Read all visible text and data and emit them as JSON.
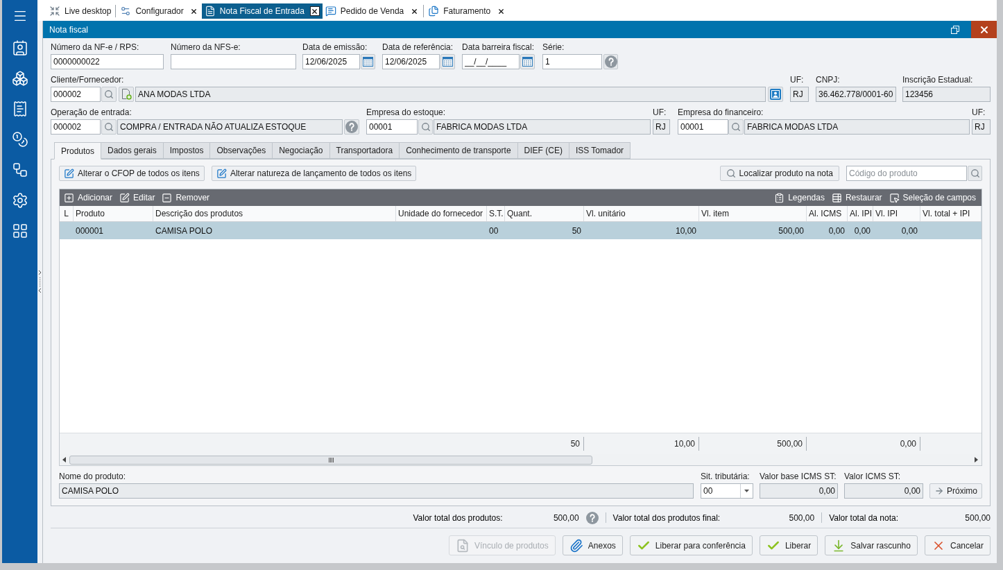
{
  "tabs": [
    {
      "label": "Live desktop",
      "selected": false,
      "closable": false
    },
    {
      "label": "Configurador",
      "selected": false,
      "closable": true
    },
    {
      "label": "Nota Fiscal de Entrada",
      "selected": true,
      "closable": true
    },
    {
      "label": "Pedido de Venda",
      "selected": false,
      "closable": true
    },
    {
      "label": "Faturamento",
      "selected": false,
      "closable": true
    }
  ],
  "window": {
    "title": "Nota fiscal"
  },
  "document": {
    "nfe_number": {
      "label": "Número da NF-e / RPS:",
      "value": "0000000022"
    },
    "nfse_number": {
      "label": "Número da NFS-e:"
    },
    "issue_date": {
      "label": "Data de emissão:",
      "value": "12/06/2025"
    },
    "reference_date": {
      "label": "Data de referência:",
      "value": "12/06/2025"
    },
    "fiscal_barrier_date": {
      "label": "Data barreira fiscal:",
      "value": "__/__/____"
    },
    "series": {
      "label": "Série:",
      "value": "1"
    }
  },
  "supplier": {
    "label": "Cliente/Fornecedor:",
    "code": "000002",
    "name": "ANA MODAS LTDA",
    "uf": {
      "label": "UF:",
      "value": "RJ"
    },
    "cnpj": {
      "label": "CNPJ:",
      "value": "36.462.778/0001-60"
    },
    "state_registration": {
      "label": "Inscrição Estadual:",
      "value": "123456"
    }
  },
  "operation": {
    "label": "Operação de entrada:",
    "code": "000002",
    "description": "COMPRA / ENTRADA NÃO ATUALIZA ESTOQUE"
  },
  "stock_company": {
    "label": "Empresa do estoque:",
    "code": "00001",
    "name": "FABRICA MODAS LTDA",
    "uf": {
      "label": "UF:",
      "value": "RJ"
    }
  },
  "finance_company": {
    "label": "Empresa do financeiro:",
    "code": "00001",
    "name": "FABRICA MODAS LTDA",
    "uf": {
      "label": "UF:",
      "value": "RJ"
    }
  },
  "section_tabs": [
    {
      "label": "Produtos",
      "selected": true
    },
    {
      "label": "Dados gerais",
      "selected": false
    },
    {
      "label": "Impostos",
      "selected": false
    },
    {
      "label": "Observações",
      "selected": false
    },
    {
      "label": "Negociação",
      "selected": false
    },
    {
      "label": "Transportadora",
      "selected": false
    },
    {
      "label": "Conhecimento de transporte",
      "selected": false
    },
    {
      "label": "DIEF (CE)",
      "selected": false
    },
    {
      "label": "ISS Tomador",
      "selected": false
    }
  ],
  "products": {
    "actions": [
      "Alterar o CFOP de todos os itens",
      "Alterar natureza de lançamento de todos os itens"
    ],
    "locate_button": "Localizar produto na nota",
    "product_code_search": {
      "placeholder": "Código do produto"
    },
    "grid_toolbar": {
      "left": [
        "Adicionar",
        "Editar",
        "Remover"
      ],
      "right": [
        "Legendas",
        "Restaurar",
        "Seleção de campos"
      ]
    },
    "table": {
      "columns": [
        "L",
        "Produto",
        "Descrição dos produtos",
        "Unidade do fornecedor",
        "S.T.",
        "Quant.",
        "Vl. unitário",
        "Vl. item",
        "Al. ICMS",
        "Al. IPI",
        "Vl. IPI",
        "Vl. total + IPI"
      ],
      "rows": [
        {
          "selected": true,
          "cells": [
            null,
            "000001",
            "CAMISA POLO",
            null,
            "00",
            "50",
            "10,00",
            "500,00",
            "0,00",
            "0,00",
            "0,00",
            null
          ]
        }
      ],
      "totals": [
        "50",
        "10,00",
        "500,00",
        "0,00"
      ]
    },
    "product_name": {
      "label": "Nome do produto:",
      "value": "CAMISA POLO"
    },
    "tax_situation": {
      "label": "Sit. tributária:",
      "value": "00"
    },
    "icms_st_base": {
      "label": "Valor base ICMS ST:",
      "value": "0,00"
    },
    "icms_st_value": {
      "label": "Valor ICMS ST:",
      "value": "0,00"
    },
    "next_button": "Próximo"
  },
  "totals": [
    {
      "label": "Valor total dos produtos:",
      "value": "500,00",
      "help": true
    },
    {
      "label": "Valor total dos produtos final:",
      "value": "500,00",
      "help": false
    },
    {
      "label": "Valor total da nota:",
      "value": "500,00",
      "help": false
    }
  ],
  "buttons": [
    {
      "label": "Vínculo de produtos",
      "disabled": true
    },
    {
      "label": "Anexos",
      "disabled": false
    },
    {
      "label": "Liberar para conferência",
      "disabled": false
    },
    {
      "label": "Liberar",
      "disabled": false
    },
    {
      "label": "Salvar rascunho",
      "disabled": false
    },
    {
      "label": "Cancelar",
      "disabled": false
    }
  ]
}
